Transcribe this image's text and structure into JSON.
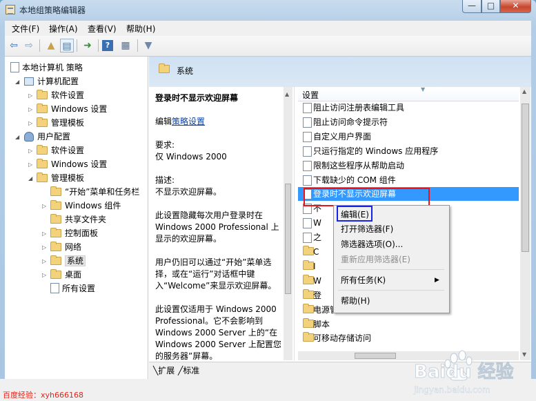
{
  "window": {
    "title": "本地组策略编辑器",
    "min": "—",
    "max": "□",
    "close": "✕"
  },
  "menubar": [
    {
      "label": "文件(F)"
    },
    {
      "label": "操作(A)"
    },
    {
      "label": "查看(V)"
    },
    {
      "label": "帮助(H)"
    }
  ],
  "toolbar_icons": [
    "back-arrow-icon",
    "forward-arrow-icon",
    "up-folder-icon",
    "show-hide-tree-icon",
    "export-icon",
    "help-icon",
    "properties-icon",
    "filter-icon"
  ],
  "tree": [
    {
      "label": "本地计算机 策略"
    },
    {
      "label": "计算机配置"
    },
    {
      "label": "软件设置"
    },
    {
      "label": "Windows 设置"
    },
    {
      "label": "管理模板"
    },
    {
      "label": "用户配置"
    },
    {
      "label": "软件设置"
    },
    {
      "label": "Windows 设置"
    },
    {
      "label": "管理模板"
    },
    {
      "label": "“开始”菜单和任务栏"
    },
    {
      "label": "Windows 组件"
    },
    {
      "label": "共享文件夹"
    },
    {
      "label": "控制面板"
    },
    {
      "label": "网络"
    },
    {
      "label": "系统"
    },
    {
      "label": "桌面"
    },
    {
      "label": "所有设置"
    }
  ],
  "header": {
    "folder_title": "系统"
  },
  "description": {
    "title": "登录时不显示欢迎屏幕",
    "edit_prefix": "编辑",
    "edit_link": "策略设置",
    "req_label": "要求:",
    "req_value": "仅 Windows 2000",
    "desc_label": "描述:",
    "desc_value": "不显示欢迎屏幕。",
    "p1": "此设置隐藏每次用户登录时在 Windows 2000 Professional 上显示的欢迎屏幕。",
    "p2": "用户仍旧可以通过“开始”菜单选择，或在“运行”对话框中键入“Welcome”来显示欢迎屏幕。",
    "p3": "此设置仅适用于 Windows 2000 Professional。它不会影响到 Windows 2000 Server 上的“在 Windows 2000 Server 上配置您的服务器”屏幕。"
  },
  "list": {
    "column_header": "设置",
    "rows": [
      {
        "label": "阻止访问注册表编辑工具",
        "type": "setting"
      },
      {
        "label": "阻止访问命令提示符",
        "type": "setting"
      },
      {
        "label": "自定义用户界面",
        "type": "setting"
      },
      {
        "label": "只运行指定的 Windows 应用程序",
        "type": "setting"
      },
      {
        "label": "限制这些程序从帮助启动",
        "type": "setting"
      },
      {
        "label": "下载缺少的 COM 组件",
        "type": "setting"
      },
      {
        "label": "登录时不显示欢迎屏幕",
        "type": "setting",
        "selected": true
      },
      {
        "label": "不",
        "type": "setting"
      },
      {
        "label": "W",
        "type": "setting"
      },
      {
        "label": "之",
        "type": "setting"
      },
      {
        "label": "C",
        "type": "folder"
      },
      {
        "label": "I",
        "type": "folder"
      },
      {
        "label": "W",
        "type": "folder"
      },
      {
        "label": "登",
        "type": "folder"
      },
      {
        "label": "电源管理",
        "type": "folder"
      },
      {
        "label": "脚本",
        "type": "folder"
      },
      {
        "label": "可移动存储访问",
        "type": "folder"
      }
    ]
  },
  "context_menu": {
    "edit": "编辑(E)",
    "open_filter": "打开筛选器(F)",
    "filter_options": "筛选器选项(O)...",
    "reapply_filter": "重新应用筛选器(E)",
    "all_tasks": "所有任务(K)",
    "help": "帮助(H)"
  },
  "tabs": {
    "expand": "扩展",
    "standard": "标准"
  },
  "watermark": {
    "left": "百度经验：xyh666168",
    "brand": "Baidu 经验",
    "url": "jingyan.baidu.com"
  },
  "colors": {
    "selection": "#3399ff",
    "red_box": "#e8141c",
    "blue_box": "#1622e6"
  }
}
